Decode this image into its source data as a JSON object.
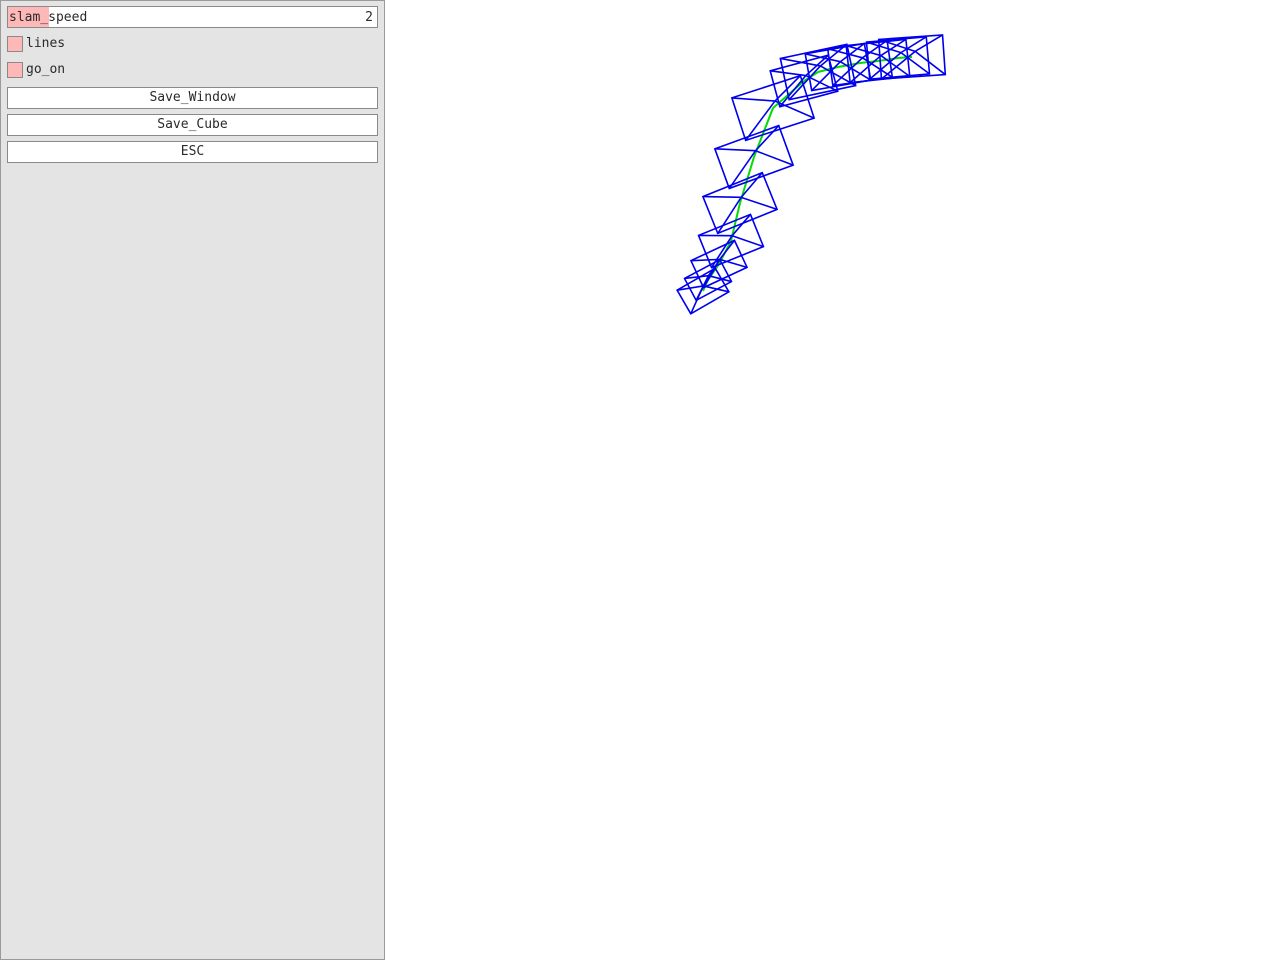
{
  "panel": {
    "slider": {
      "label": "slam_speed",
      "value": "2",
      "fill_fraction": 0.11
    },
    "checkboxes": [
      {
        "label": "lines",
        "checked": false
      },
      {
        "label": "go_on",
        "checked": false
      }
    ],
    "buttons": [
      {
        "label": "Save_Window"
      },
      {
        "label": "Save_Cube"
      },
      {
        "label": "ESC"
      }
    ]
  },
  "colors": {
    "panel_bg": "#e4e4e4",
    "accent": "#ffb8b8",
    "camera_frustum": "#0000ee",
    "trajectory": "#00dd00"
  },
  "icons": [
    "camera-frustum-icon"
  ]
}
